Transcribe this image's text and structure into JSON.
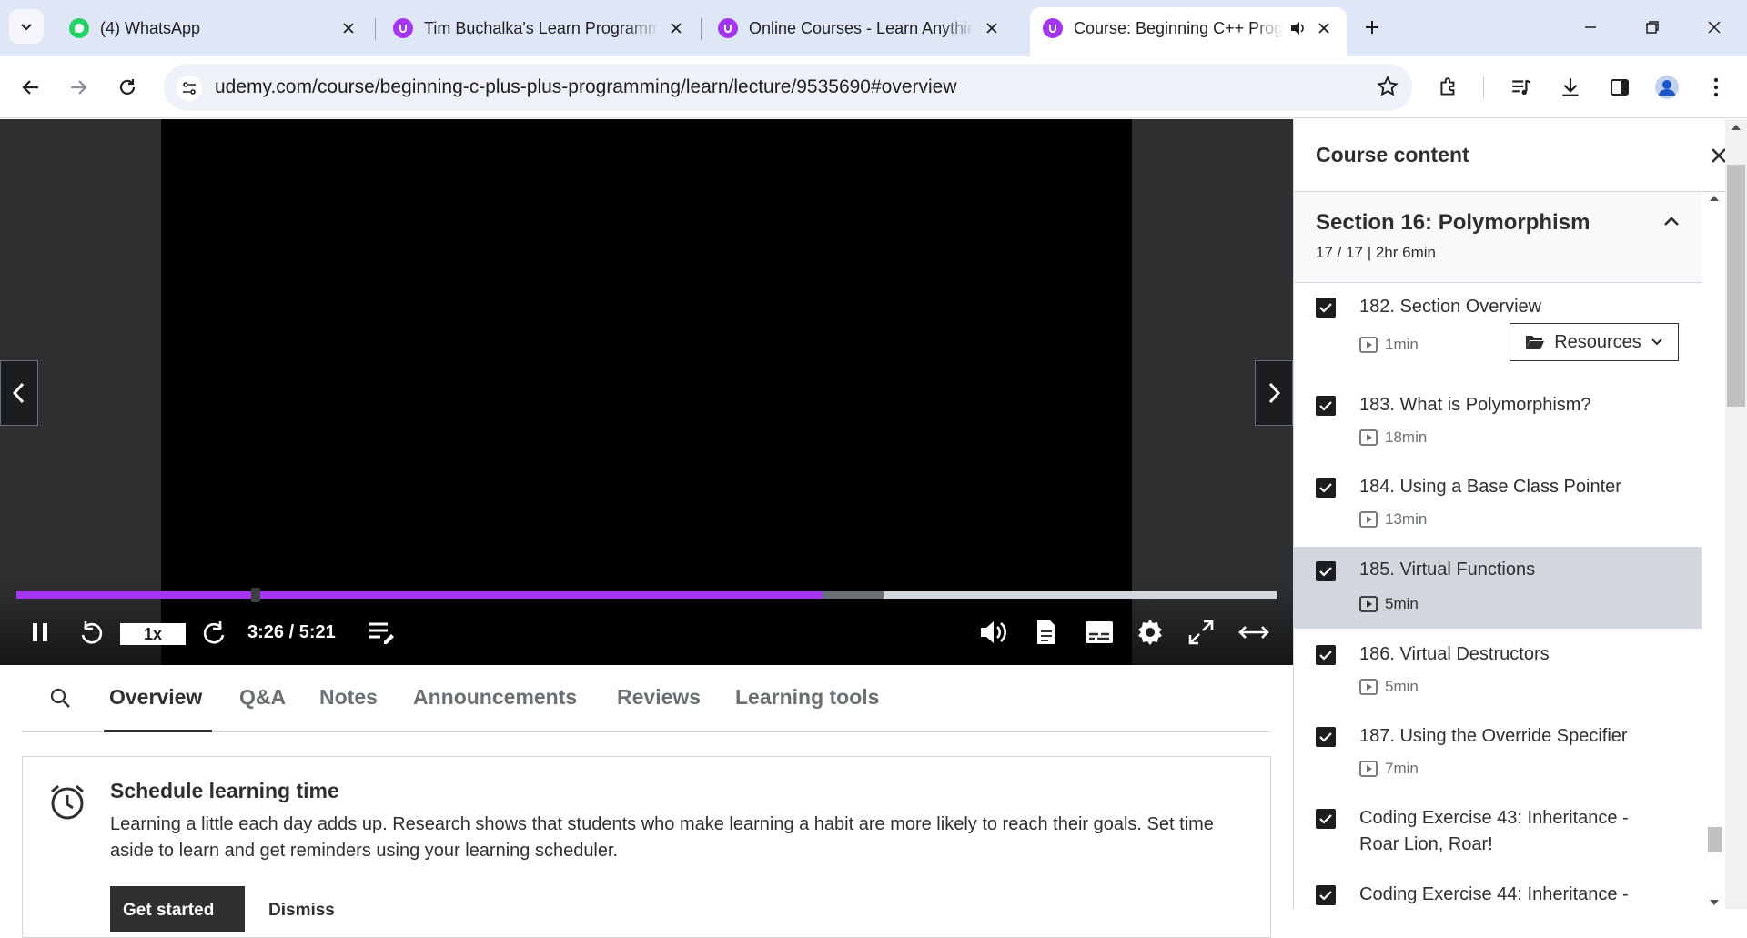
{
  "browser": {
    "tabs": [
      {
        "title": "(4) WhatsApp",
        "favicon": "whatsapp-icon"
      },
      {
        "title": "Tim Buchalka's Learn Programming",
        "favicon": "udemy-icon"
      },
      {
        "title": "Online Courses - Learn Anything",
        "favicon": "udemy-icon"
      },
      {
        "title": "Course: Beginning C++ Programming",
        "favicon": "udemy-icon",
        "active": true,
        "audio": true
      }
    ],
    "url": "udemy.com/course/beginning-c-plus-plus-programming/learn/lecture/9535690#overview"
  },
  "player": {
    "speed": "1x",
    "time": "3:26 / 5:21",
    "progress_fraction": 0.64,
    "buffered_fraction": 0.688,
    "accent": "#a435f0"
  },
  "content_tabs": {
    "items": [
      "Overview",
      "Q&A",
      "Notes",
      "Announcements",
      "Reviews",
      "Learning tools"
    ],
    "active": "Overview"
  },
  "schedule": {
    "title": "Schedule learning time",
    "text": "Learning a little each day adds up. Research shows that students who make learning a habit are more likely to reach their goals. Set time aside to learn and get reminders using your learning scheduler.",
    "primary_label": "Get started",
    "secondary_label": "Dismiss"
  },
  "sidebar": {
    "title": "Course content",
    "section_title": "Section 16: Polymorphism",
    "section_meta": "17 / 17 | 2hr 6min",
    "resources_label": "Resources",
    "items": [
      {
        "label": "182. Section Overview",
        "duration": "1min",
        "checked": true
      },
      {
        "label": "183. What is Polymorphism?",
        "duration": "18min",
        "checked": true
      },
      {
        "label": "184. Using a Base Class Pointer",
        "duration": "13min",
        "checked": true
      },
      {
        "label": "185. Virtual Functions",
        "duration": "5min",
        "checked": true,
        "current": true
      },
      {
        "label": "186. Virtual Destructors",
        "duration": "5min",
        "checked": true
      },
      {
        "label": "187. Using the Override Specifier",
        "duration": "7min",
        "checked": true
      },
      {
        "label": "Coding Exercise 43: Inheritance - Roar Lion, Roar!",
        "checked": true
      },
      {
        "label": "Coding Exercise 44: Inheritance -",
        "checked": true
      }
    ]
  }
}
